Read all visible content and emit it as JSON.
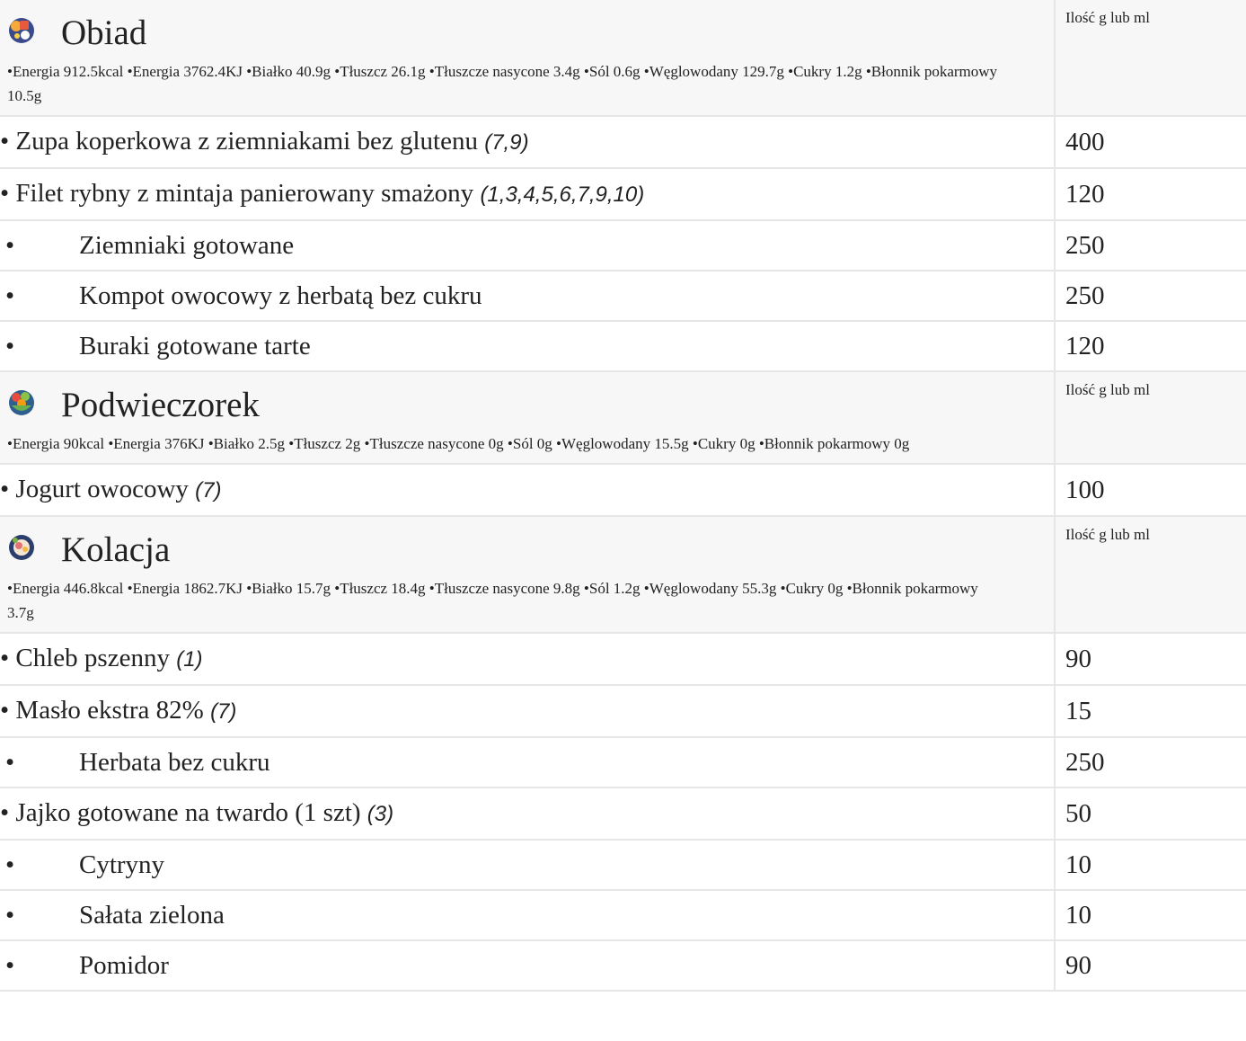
{
  "sections": [
    {
      "title": "Obiad",
      "icon": "lunch-plate-icon",
      "qty_header": "Ilość g lub ml",
      "nutrition": "•Energia 912.5kcal •Energia 3762.4KJ •Białko 40.9g •Tłuszcz 26.1g •Tłuszcze nasycone 3.4g •Sól 0.6g •Węglowodany 129.7g •Cukry 1.2g •Błonnik pokarmowy 10.5g",
      "items": [
        {
          "name": "Zupa koperkowa z ziemniakami bez glutenu",
          "allergens": "(7,9)",
          "qty": "400"
        },
        {
          "name": "Filet rybny z mintaja panierowany smażony",
          "allergens": "(1,3,4,5,6,7,9,10)",
          "qty": "120"
        },
        {
          "name": "Ziemniaki gotowane",
          "allergens": "",
          "qty": "250"
        },
        {
          "name": "Kompot owocowy z herbatą bez cukru",
          "allergens": "",
          "qty": "250"
        },
        {
          "name": "Buraki gotowane tarte",
          "allergens": "",
          "qty": "120"
        }
      ]
    },
    {
      "title": "Podwieczorek",
      "icon": "fruit-bowl-icon",
      "qty_header": "Ilość g lub ml",
      "nutrition": "•Energia 90kcal •Energia 376KJ •Białko 2.5g •Tłuszcz 2g •Tłuszcze nasycone 0g •Sól 0g •Węglowodany 15.5g •Cukry 0g •Błonnik pokarmowy 0g",
      "items": [
        {
          "name": "Jogurt owocowy",
          "allergens": "(7)",
          "qty": "100"
        }
      ]
    },
    {
      "title": "Kolacja",
      "icon": "dinner-plate-icon",
      "qty_header": "Ilość g lub ml",
      "nutrition": "•Energia 446.8kcal •Energia 1862.7KJ •Białko 15.7g •Tłuszcz 18.4g •Tłuszcze nasycone 9.8g •Sól 1.2g •Węglowodany 55.3g •Cukry 0g •Błonnik pokarmowy 3.7g",
      "items": [
        {
          "name": "Chleb pszenny",
          "allergens": "(1)",
          "qty": "90"
        },
        {
          "name": "Masło ekstra 82%",
          "allergens": "(7)",
          "qty": "15"
        },
        {
          "name": "Herbata bez cukru",
          "allergens": "",
          "qty": "250"
        },
        {
          "name": "Jajko gotowane na twardo (1 szt)",
          "allergens": "(3)",
          "qty": "50"
        },
        {
          "name": "Cytryny",
          "allergens": "",
          "qty": "10"
        },
        {
          "name": "Sałata zielona",
          "allergens": "",
          "qty": "10"
        },
        {
          "name": "Pomidor",
          "allergens": "",
          "qty": "90"
        }
      ]
    }
  ]
}
